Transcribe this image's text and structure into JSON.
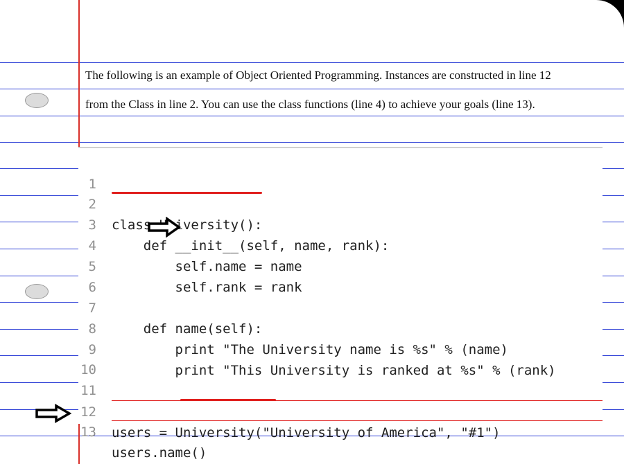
{
  "intro": {
    "line1": "The following is an example of Object Oriented Programming. Instances are constructed in line 12",
    "line2": "from the Class in line 2. You can use the class functions (line 4) to achieve your goals (line 13)."
  },
  "code": {
    "lines": [
      {
        "num": "1",
        "text": ""
      },
      {
        "num": "2",
        "text": "class University():"
      },
      {
        "num": "3",
        "text": "    def __init__(self, name, rank):"
      },
      {
        "num": "4",
        "text": "        self.name = name"
      },
      {
        "num": "5",
        "text": "        self.rank = rank"
      },
      {
        "num": "6",
        "text": ""
      },
      {
        "num": "7",
        "text": "    def name(self):"
      },
      {
        "num": "8",
        "text": "        print \"The University name is %s\" % (name)"
      },
      {
        "num": "9",
        "text": "        print \"This University is ranked at %s\" % (rank)"
      },
      {
        "num": "10",
        "text": ""
      },
      {
        "num": "11",
        "text": ""
      },
      {
        "num": "12",
        "text": "users = University(\"University of America\", \"#1\")"
      },
      {
        "num": "13",
        "text": "users.name()"
      }
    ]
  },
  "colors": {
    "rule_line": "#2d3fd6",
    "margin_line": "#d9302a",
    "highlight": "#e0201e",
    "line_number": "#909090"
  },
  "icons": [
    "arrow-right-icon-line-4",
    "arrow-right-icon-line-13",
    "binder-hole"
  ]
}
